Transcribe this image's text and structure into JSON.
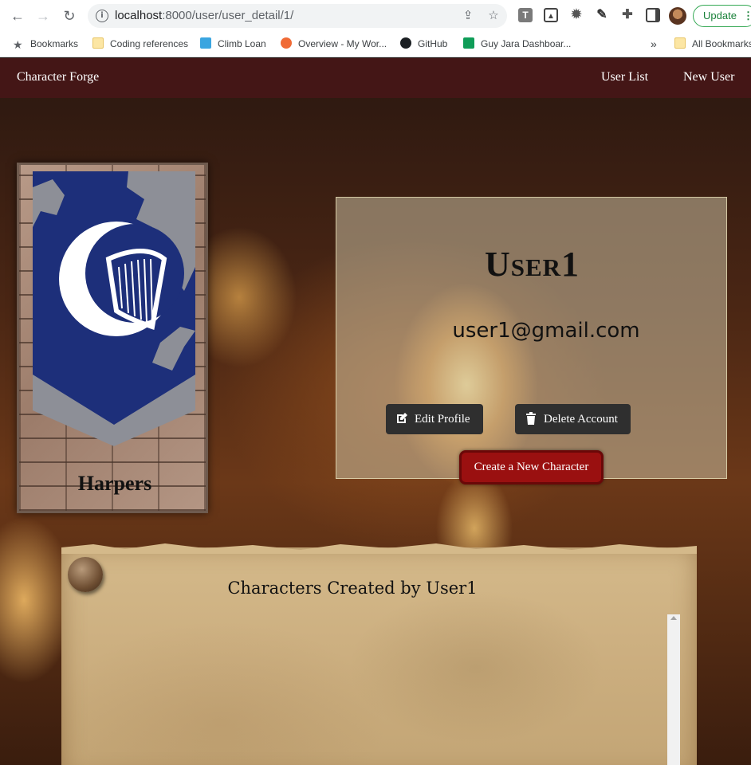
{
  "browser": {
    "url_host": "localhost",
    "url_rest": ":8000/user/user_detail/1/",
    "update_label": "Update",
    "bookmarks": [
      {
        "label": "Bookmarks"
      },
      {
        "label": "Coding references"
      },
      {
        "label": "Climb Loan"
      },
      {
        "label": "Overview - My Wor..."
      },
      {
        "label": "GitHub"
      },
      {
        "label": "Guy Jara Dashboar..."
      }
    ],
    "overflow_label": "»",
    "all_bookmarks_label": "All Bookmarks"
  },
  "navbar": {
    "brand": "Character Forge",
    "links": [
      "User List",
      "New User"
    ]
  },
  "banner": {
    "title": "Harpers"
  },
  "profile": {
    "username": "User1",
    "email": "user1@gmail.com",
    "edit_label": "Edit Profile",
    "delete_label": "Delete Account",
    "create_label": "Create a New Character"
  },
  "characters": {
    "heading": "Characters Created by User1",
    "items": []
  },
  "colors": {
    "navbar": "#441616",
    "create_button": "#9a1010",
    "dark_button": "#2f2f2f",
    "banner_blue": "#1d2f7a"
  }
}
